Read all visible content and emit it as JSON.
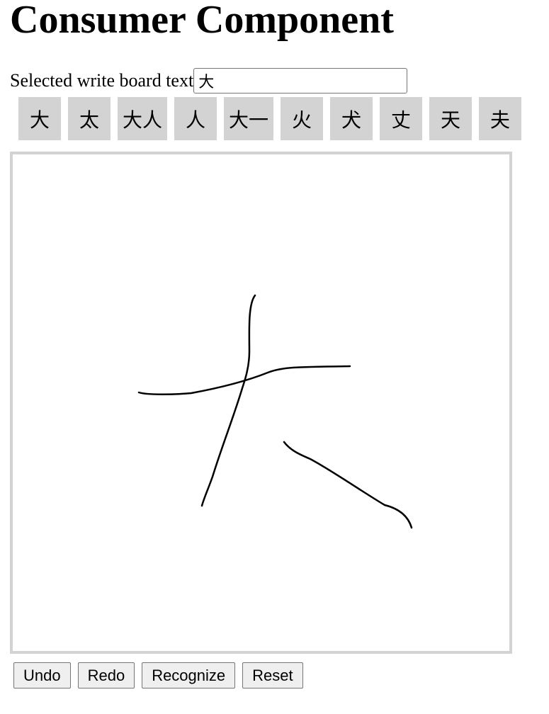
{
  "page": {
    "title": "Consumer Component"
  },
  "selection": {
    "label": "Selected write board text",
    "value": "大"
  },
  "candidates": [
    "大",
    "太",
    "大人",
    "人",
    "大一",
    "火",
    "犬",
    "丈",
    "天",
    "夫"
  ],
  "board": {
    "stroke_color": "#000000",
    "border_color": "#d3d3d3"
  },
  "buttons": {
    "undo": "Undo",
    "redo": "Redo",
    "recognize": "Recognize",
    "reset": "Reset"
  }
}
